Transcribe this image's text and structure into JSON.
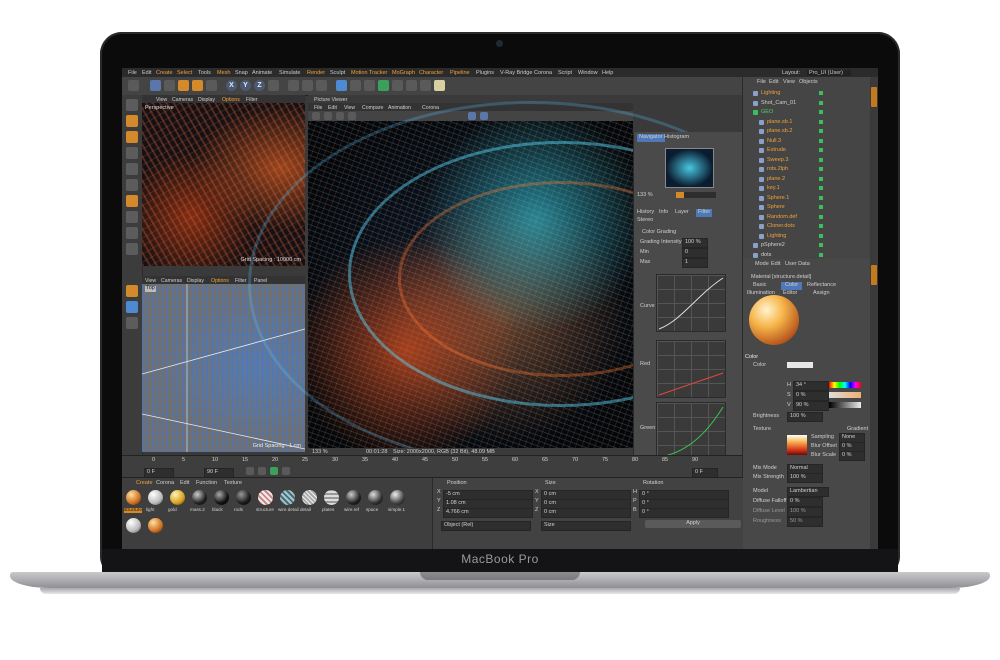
{
  "device": {
    "brand": "MacBook Pro"
  },
  "menubar": {
    "items": [
      "File",
      "Edit",
      "Create",
      "Select",
      "Tools",
      "Mesh",
      "Snap",
      "Animate",
      "Simulate",
      "Render",
      "Sculpt",
      "Motion Tracker",
      "MoGraph",
      "Character",
      "Pipeline",
      "Plugins",
      "V-Ray Bridge",
      "Corona",
      "Script",
      "Window",
      "Help"
    ],
    "layout_label": "Layout:",
    "layout_value": "Pro_UI (User)"
  },
  "toolbar": {
    "axes": [
      "X",
      "Y",
      "Z"
    ]
  },
  "viewport_top": {
    "menu": [
      "View",
      "Cameras",
      "Display",
      "Options",
      "Filter"
    ],
    "label": "Perspective",
    "grid": "Grid Spacing : 10000 cm"
  },
  "viewport_bottom": {
    "menu": [
      "View",
      "Cameras",
      "Display",
      "Options",
      "Filter",
      "Panel"
    ],
    "label": "Top",
    "grid": "Grid Spacing : 1 cm"
  },
  "picture_viewer": {
    "title": "Picture Viewer",
    "menu": [
      "File",
      "Edit",
      "View",
      "Compare",
      "Animation",
      "Corona"
    ],
    "zoom": "133 %",
    "time": "00:01:28",
    "status": "Size: 2000x2000, RGB (32 Bit), 48.09 MB"
  },
  "navigator": {
    "tabs": [
      "Navigator",
      "Histogram"
    ],
    "zoom": "133 %",
    "subtabs": [
      "History",
      "Info",
      "Layer",
      "Filter"
    ],
    "stereo": "Stereo",
    "section": "Color Grading",
    "grading_label": "Grading Intensity",
    "grading_value": "100 %",
    "min_label": "Min",
    "min_value": "0",
    "max_label": "Max",
    "max_value": "1",
    "curves": [
      "Curve",
      "Red",
      "Green"
    ]
  },
  "objects": {
    "menu": [
      "File",
      "Edit",
      "View",
      "Objects"
    ],
    "items": [
      "Lighting",
      "Shot_Cam_01",
      "GEO",
      "plane.sb.1",
      "plane.sb.2",
      "Null.3",
      "Extrude",
      "Sweep.3",
      "rots.2lph",
      "plane.2",
      "key.1",
      "Sphere.1",
      "Sphere",
      "Random.def",
      "Cloner.dots",
      "Lighting",
      "pSphere2",
      "dots"
    ]
  },
  "attributes": {
    "menu": [
      "Mode",
      "Edit",
      "User Data"
    ],
    "material": "Material [structure.detail]",
    "tabs": [
      "Basic",
      "Color",
      "Reflectance",
      "Illumination",
      "Editor",
      "Assign"
    ],
    "section": "Color",
    "color_label": "Color",
    "h_label": "H",
    "h_value": "34 °",
    "s_label": "S",
    "s_value": "0 %",
    "v_label": "V",
    "v_value": "90 %",
    "brightness_label": "Brightness",
    "brightness_value": "100 %",
    "texture_label": "Texture",
    "gradient_label": "Gradient",
    "sampling_label": "Sampling",
    "sampling_value": "None",
    "blur_offset_label": "Blur Offset",
    "blur_offset_value": "0 %",
    "blur_scale_label": "Blur Scale",
    "blur_scale_value": "0 %",
    "mix_mode_label": "Mix Mode",
    "mix_mode_value": "Normal",
    "mix_strength_label": "Mix Strength",
    "mix_strength_value": "100 %",
    "model_label": "Model",
    "model_value": "Lambertian",
    "diffuse_falloff_label": "Diffuse Falloff",
    "diffuse_falloff_value": "0 %",
    "diffuse_level_label": "Diffuse Level",
    "diffuse_level_value": "100 %",
    "roughness_label": "Roughness",
    "roughness_value": "50 %"
  },
  "timeline": {
    "ticks": [
      "0",
      "5",
      "10",
      "15",
      "20",
      "25",
      "30",
      "35",
      "40",
      "45",
      "50",
      "55",
      "60",
      "65",
      "70",
      "75",
      "80",
      "85",
      "90"
    ],
    "start": "0 F",
    "end": "90 F",
    "current": "0 F"
  },
  "materials": {
    "menu": [
      "Create",
      "Corona",
      "Edit",
      "Function",
      "Texture"
    ],
    "items": [
      "structure",
      "light",
      "gold",
      "mass.2",
      "black",
      "rods",
      "structure",
      "wire.detail",
      "detail",
      "plates",
      "wire.ref",
      "space",
      "simple.1"
    ]
  },
  "coordinates": {
    "headers": [
      "Position",
      "Size",
      "Rotation"
    ],
    "rows": [
      {
        "axis": "X",
        "pos": "-5 cm",
        "size_axis": "X",
        "size": "0 cm",
        "rot_axis": "H",
        "rot": "0 °"
      },
      {
        "axis": "Y",
        "pos": "1.08 cm",
        "size_axis": "Y",
        "size": "0 cm",
        "rot_axis": "P",
        "rot": "0 °"
      },
      {
        "axis": "Z",
        "pos": "4.766 cm",
        "size_axis": "Z",
        "size": "0 cm",
        "rot_axis": "B",
        "rot": "0 °"
      }
    ],
    "mode": "Object (Rel)",
    "size_mode": "Size",
    "apply": "Apply"
  },
  "colors": {
    "accent": "#f2a23a",
    "selection": "#4e78b6",
    "sphere": "#f6b64a"
  }
}
